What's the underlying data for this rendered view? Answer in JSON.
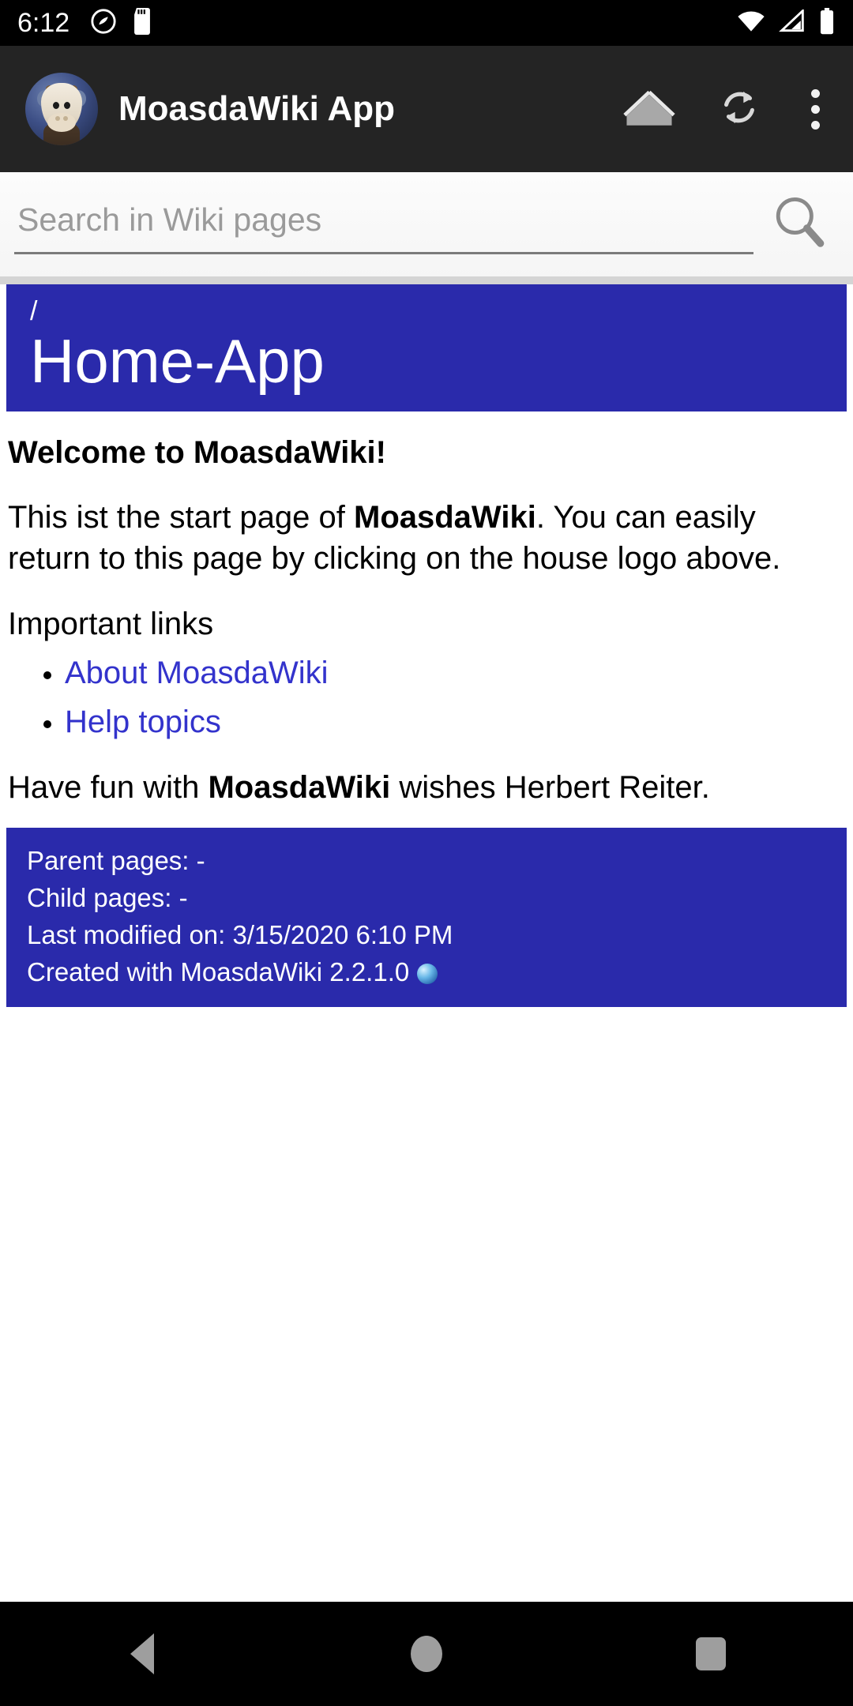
{
  "status_bar": {
    "clock": "6:12",
    "left_icons": [
      "do-not-disturb-icon",
      "sd-card-icon"
    ],
    "right_icons": [
      "wifi-icon",
      "cellular-signal-icon",
      "battery-icon"
    ]
  },
  "app_bar": {
    "logo_alt": "app-logo-cow",
    "title": "MoasdaWiki App",
    "actions": [
      {
        "name": "home-button",
        "icon": "house-icon"
      },
      {
        "name": "refresh-button",
        "icon": "refresh-icon"
      },
      {
        "name": "overflow-menu-button",
        "icon": "three-dots-icon"
      }
    ]
  },
  "search": {
    "placeholder": "Search in Wiki pages",
    "value": "",
    "icon": "search-icon"
  },
  "page": {
    "breadcrumb": "/",
    "title": "Home-App",
    "heading": "Welcome to MoasdaWiki!",
    "paragraph1_part1": "This ist the start page of ",
    "paragraph1_bold": "MoasdaWiki",
    "paragraph1_part2": ". You can easily return to this page by clicking on the house logo above.",
    "links_intro": "Important links",
    "links": [
      {
        "label": "About MoasdaWiki"
      },
      {
        "label": "Help topics"
      }
    ],
    "paragraph2_part1": "Have fun with ",
    "paragraph2_bold": "MoasdaWiki",
    "paragraph2_part2": " wishes Herbert Reiter."
  },
  "info_box": {
    "parent_pages": "Parent pages: -",
    "child_pages": "Child pages: -",
    "last_modified": "Last modified on: 3/15/2020 6:10 PM",
    "created_with": "Created with MoasdaWiki 2.2.1.0",
    "created_with_icon": "globe-icon"
  },
  "nav_bar": {
    "back": "back-button",
    "home": "home-button",
    "recents": "recents-button"
  },
  "colors": {
    "accent_blue": "#2a2aab",
    "link_blue": "#3333cc",
    "appbar_dark": "#242424",
    "status_black": "#000000"
  }
}
